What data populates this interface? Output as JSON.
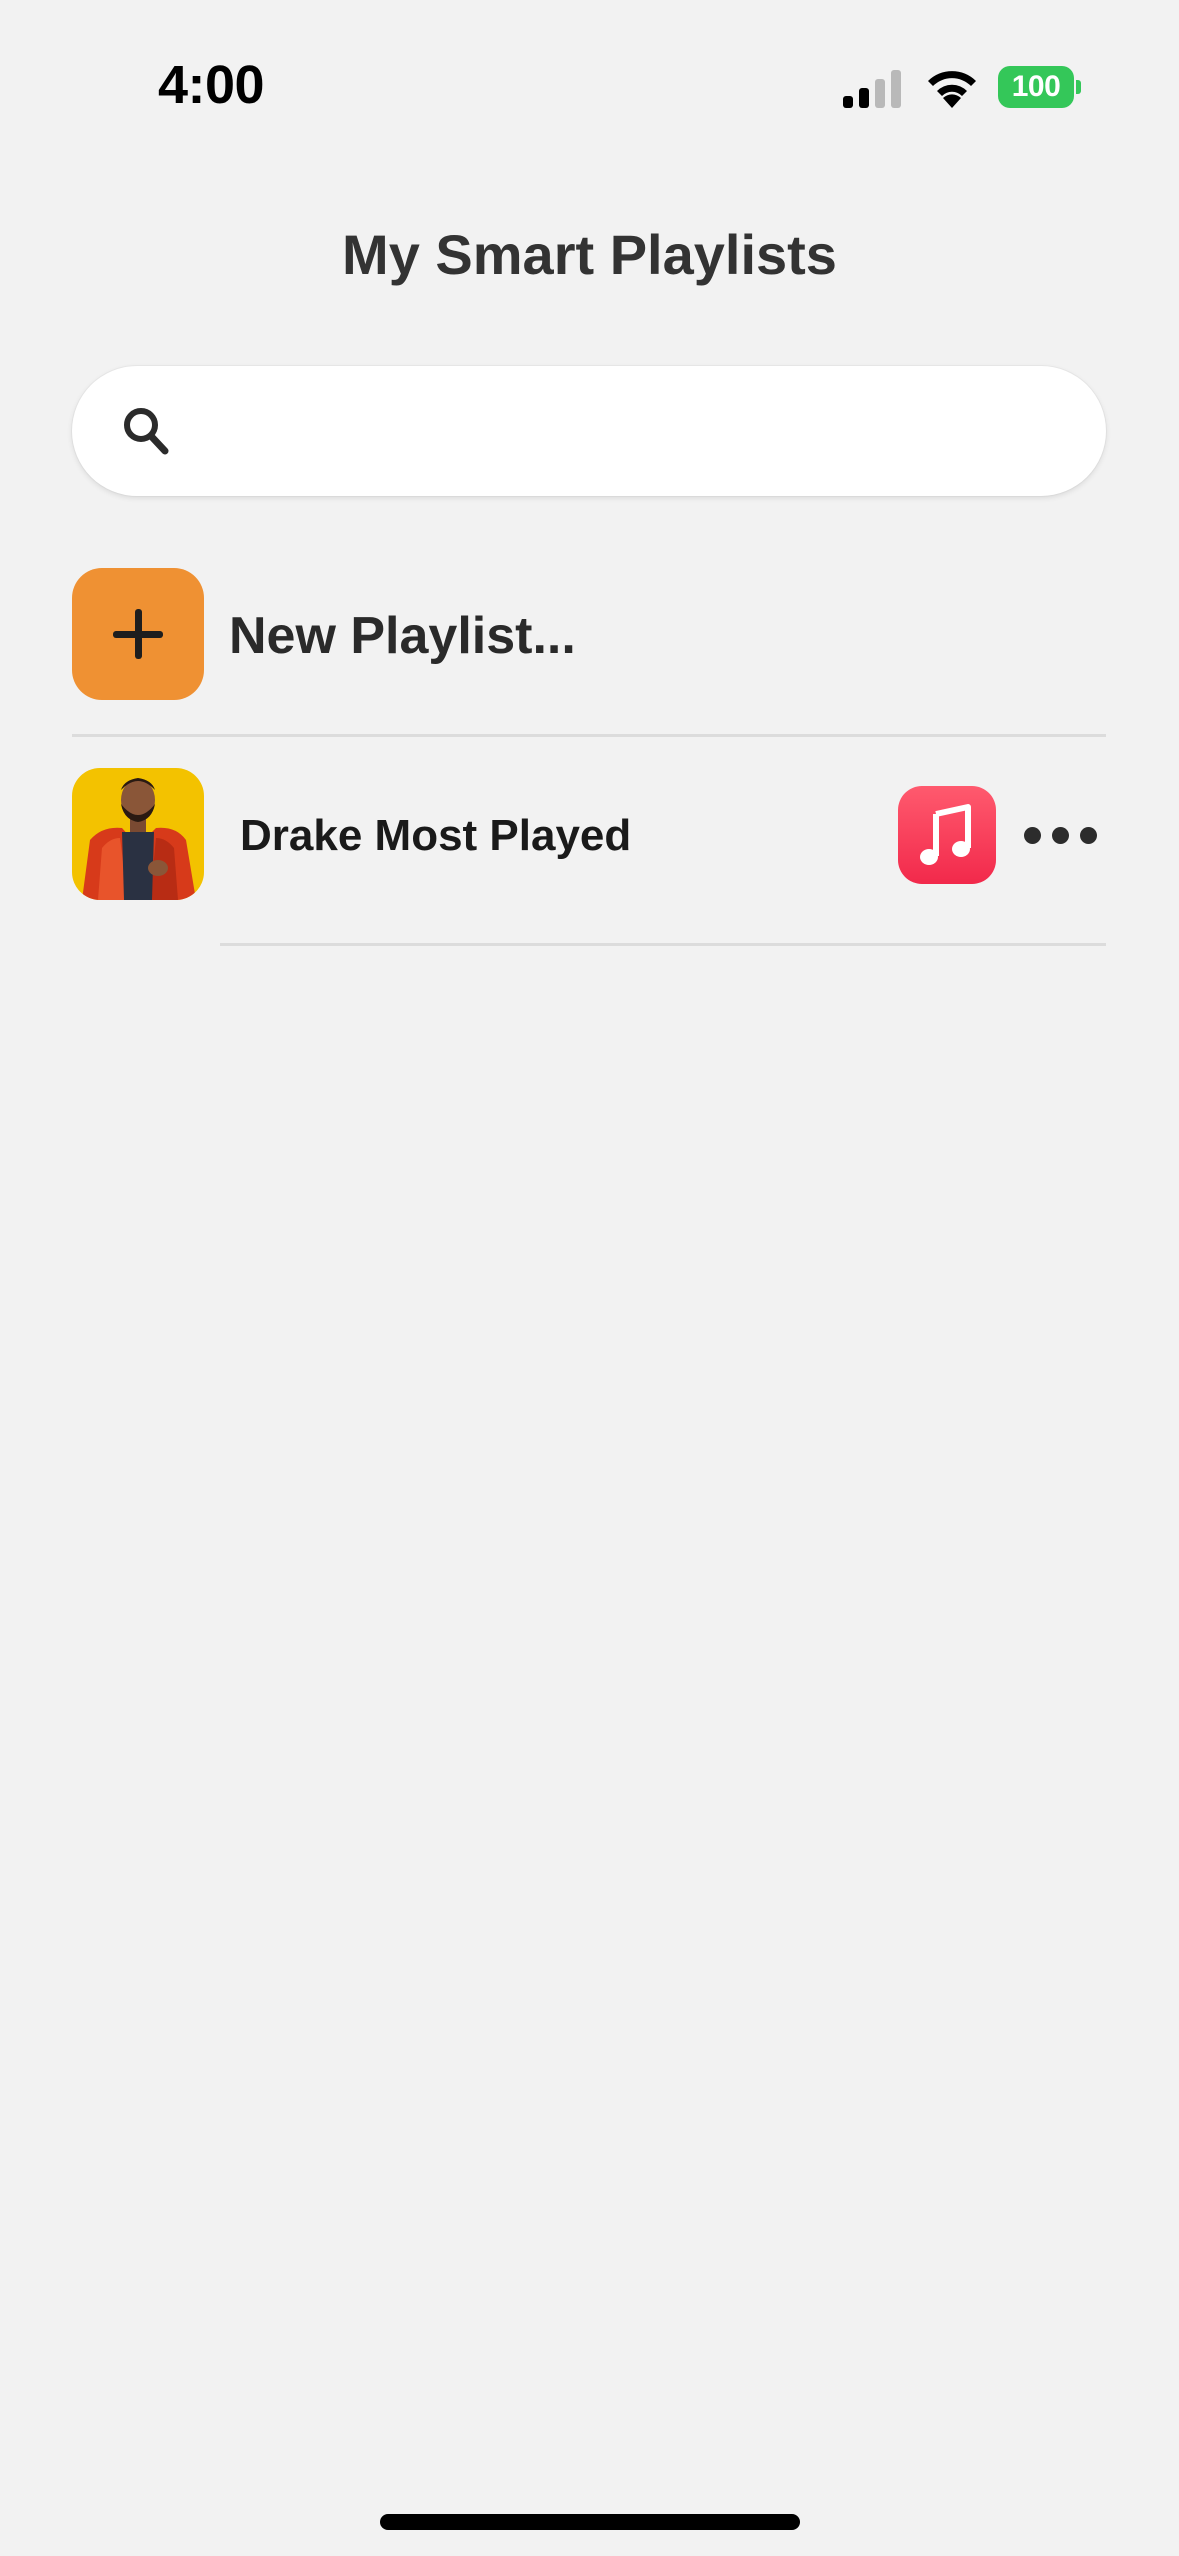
{
  "status_bar": {
    "time": "4:00",
    "battery_level": "100",
    "signal_bars_active": 2,
    "signal_bars_total": 4,
    "icons": [
      "signal-icon",
      "wifi-icon",
      "battery-icon"
    ],
    "battery_color": "#34c759"
  },
  "header": {
    "title": "My Smart Playlists"
  },
  "search": {
    "value": "",
    "placeholder": "",
    "icon": "search-icon"
  },
  "new_playlist": {
    "label": "New Playlist...",
    "icon": "plus-icon",
    "icon_color": "#ef9133"
  },
  "playlists": [
    {
      "title": "Drake Most Played",
      "artwork": "drake-artwork",
      "service_icon": "apple-music-icon",
      "service_color": "#f2294b",
      "more_icon": "ellipsis-icon"
    }
  ]
}
